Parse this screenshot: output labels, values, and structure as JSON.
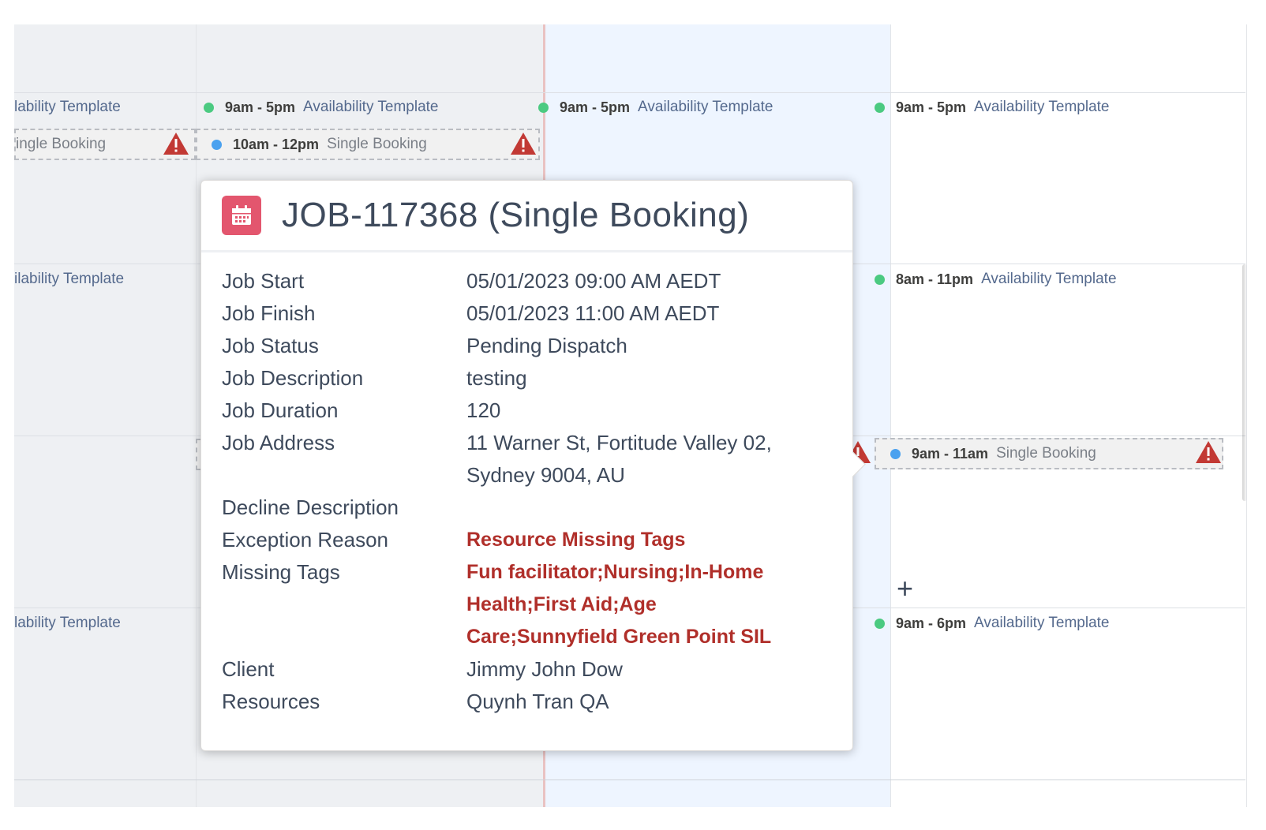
{
  "calendar": {
    "row1": {
      "c0": {
        "label": "lability Template"
      },
      "c1": {
        "time": "9am - 5pm",
        "label": "Availability Template"
      },
      "c2": {
        "time": "9am - 5pm",
        "label": "Availability Template"
      },
      "c3": {
        "time": "9am - 5pm",
        "label": "Availability Template"
      }
    },
    "row1_bookings": {
      "c0": {
        "label": "ingle Booking"
      },
      "c1": {
        "time": "10am - 12pm",
        "label": "Single Booking"
      }
    },
    "row2": {
      "c0": {
        "label": "ilability Template"
      },
      "c3": {
        "time": "8am - 11pm",
        "label": "Availability Template"
      }
    },
    "row2_bookings": {
      "c3": {
        "time": "9am - 11am",
        "label": "Single Booking"
      }
    },
    "row3": {
      "c0": {
        "label": "lability Template"
      },
      "c3": {
        "time": "9am - 6pm",
        "label": "Availability Template"
      }
    },
    "add_symbol": "+"
  },
  "popover": {
    "title": "JOB-117368 (Single Booking)",
    "icon": "calendar-icon",
    "fields": [
      {
        "key": "Job Start",
        "value": [
          "05/01/2023 09:00 AM AEDT"
        ]
      },
      {
        "key": "Job Finish",
        "value": [
          "05/01/2023 11:00 AM AEDT"
        ]
      },
      {
        "key": "Job Status",
        "value": [
          "Pending Dispatch"
        ]
      },
      {
        "key": "Job Description",
        "value": [
          "testing"
        ]
      },
      {
        "key": "Job Duration",
        "value": [
          "120"
        ]
      },
      {
        "key": "Job Address",
        "value": [
          "11 Warner St, Fortitude Valley 02,",
          "Sydney 9004, AU"
        ]
      },
      {
        "key": "Decline Description",
        "value": [
          ""
        ]
      },
      {
        "key": "Exception Reason",
        "value": [
          "Resource Missing Tags"
        ]
      },
      {
        "key": "Missing Tags",
        "value": [
          "Fun facilitator;Nursing;In-Home",
          "Health;First Aid;Age",
          "Care;Sunnyfield Green Point SIL"
        ]
      },
      {
        "key": "Client",
        "value": [
          "Jimmy John Dow"
        ]
      },
      {
        "key": "Resources",
        "value": [
          "Quynh Tran QA"
        ]
      }
    ]
  },
  "colors": {
    "available_dot": "#4bca81",
    "booking_dot": "#4aa1ef",
    "warning": "#c23934",
    "exception_text": "#b02f2a",
    "icon_bg": "#e3566e",
    "today_column": "#eef5ff"
  }
}
